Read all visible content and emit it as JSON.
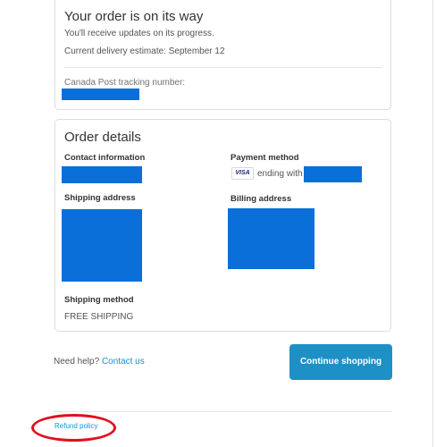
{
  "status": {
    "title": "Your order is on its way",
    "updates_text": "You'll receive updates on its progress.",
    "delivery_estimate": "Current delivery estimate: September 12",
    "tracking_label": "Canada Post tracking number:"
  },
  "details": {
    "title": "Order details",
    "contact_label": "Contact information",
    "payment_label": "Payment method",
    "card_brand": "VISA",
    "ending_with": "ending with",
    "shipping_address_label": "Shipping address",
    "billing_address_label": "Billing address",
    "shipping_method_label": "Shipping method",
    "shipping_method_value": "FREE SHIPPING"
  },
  "footer": {
    "need_help": "Need help?",
    "contact_us": "Contact us",
    "continue_shopping": "Continue shopping",
    "refund_policy": "Refund policy"
  },
  "colors": {
    "redaction": "#0a6fd9",
    "accent": "#1d90c6",
    "link": "#1990c6",
    "annotation": "#e0101d"
  }
}
